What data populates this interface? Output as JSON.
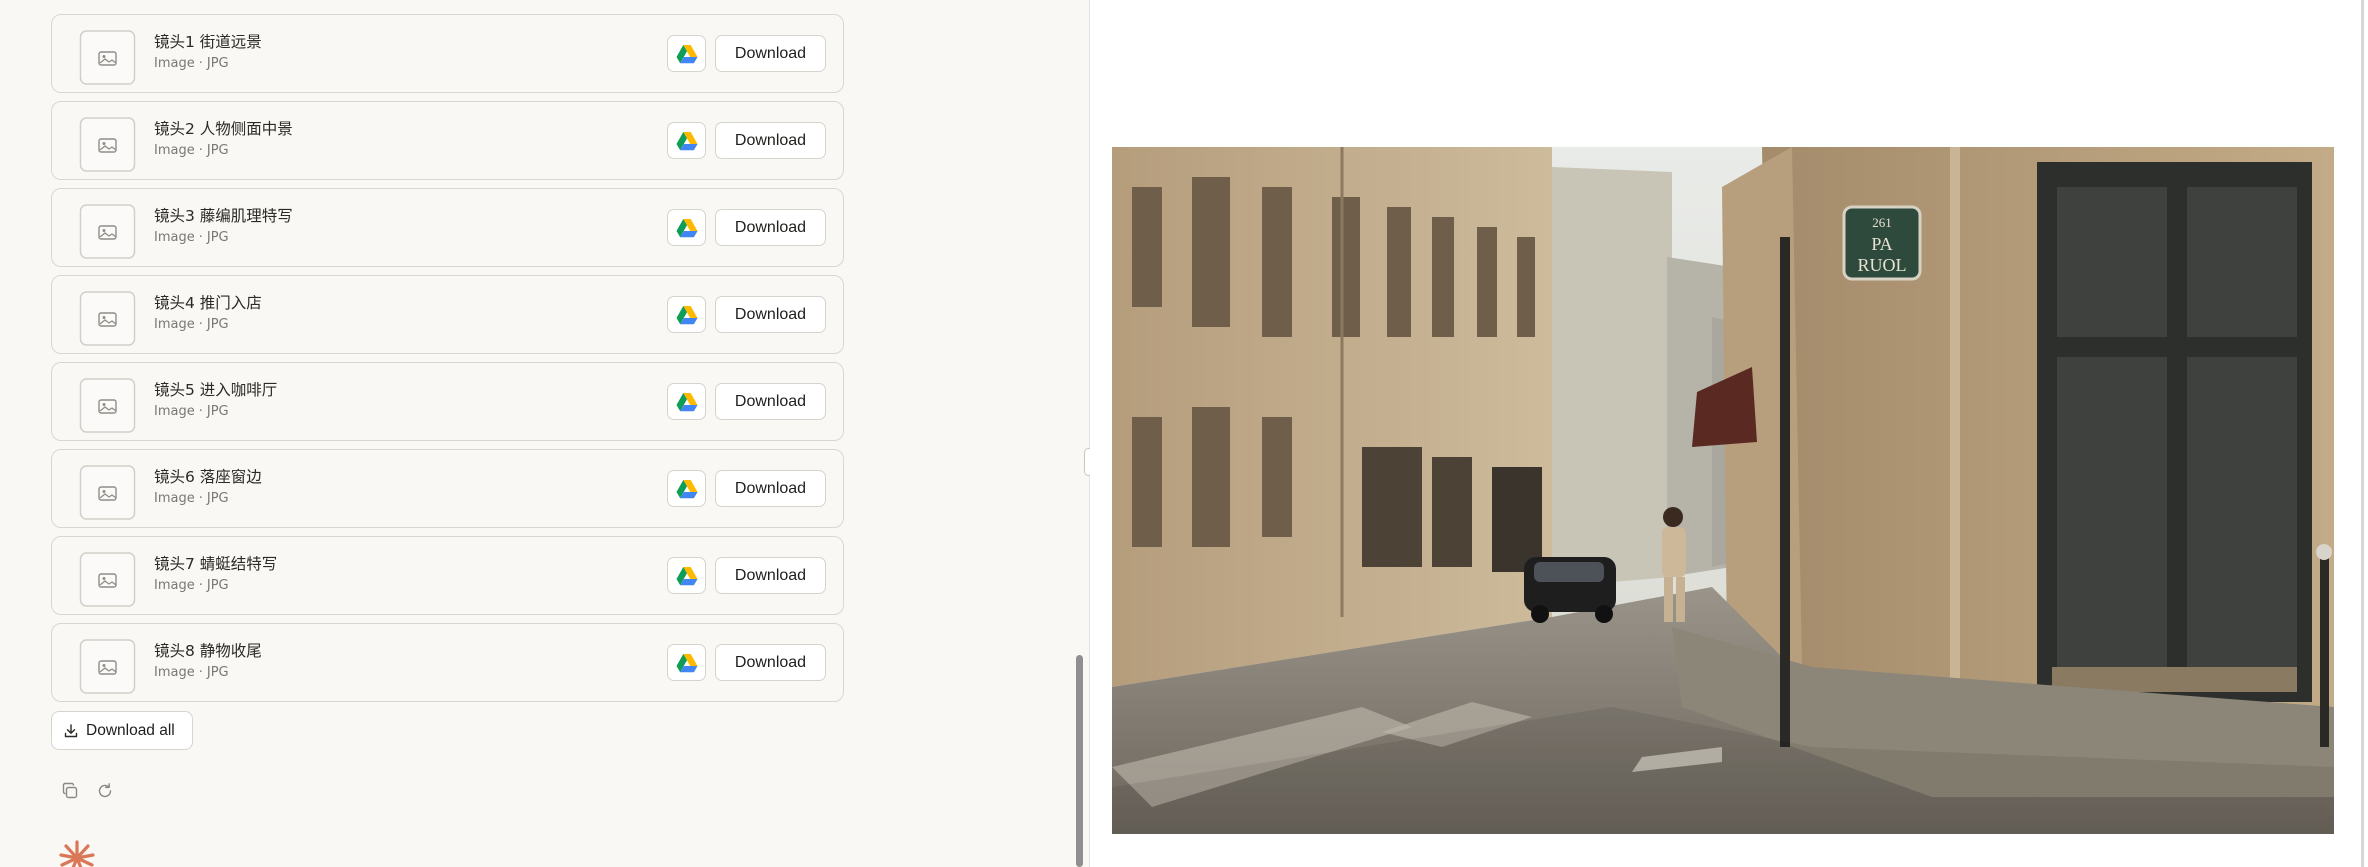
{
  "files": [
    {
      "name": "镜头1 街道远景",
      "type": "Image",
      "ext": "JPG"
    },
    {
      "name": "镜头2 人物侧面中景",
      "type": "Image",
      "ext": "JPG"
    },
    {
      "name": "镜头3 藤编肌理特写",
      "type": "Image",
      "ext": "JPG"
    },
    {
      "name": "镜头4 推门入店",
      "type": "Image",
      "ext": "JPG"
    },
    {
      "name": "镜头5 进入咖啡厅",
      "type": "Image",
      "ext": "JPG"
    },
    {
      "name": "镜头6 落座窗边",
      "type": "Image",
      "ext": "JPG"
    },
    {
      "name": "镜头7 蜻蜓结特写",
      "type": "Image",
      "ext": "JPG"
    },
    {
      "name": "镜头8 静物收尾",
      "type": "Image",
      "ext": "JPG"
    }
  ],
  "labels": {
    "download": "Download",
    "download_all": "Download all",
    "meta_separator": "·"
  },
  "icons": {
    "thumb": "image-placeholder-icon",
    "drive": "google-drive-icon",
    "copy": "copy-icon",
    "retry": "retry-icon",
    "download": "download-icon",
    "logo": "claude-spark-logo"
  },
  "preview": {
    "street_sign_number": "261",
    "street_sign_line1": "PA",
    "street_sign_line2": "RUOL"
  },
  "colors": {
    "accent_logo": "#d97757",
    "panel_bg": "#f9f8f5",
    "border": "#d9d7d0"
  }
}
